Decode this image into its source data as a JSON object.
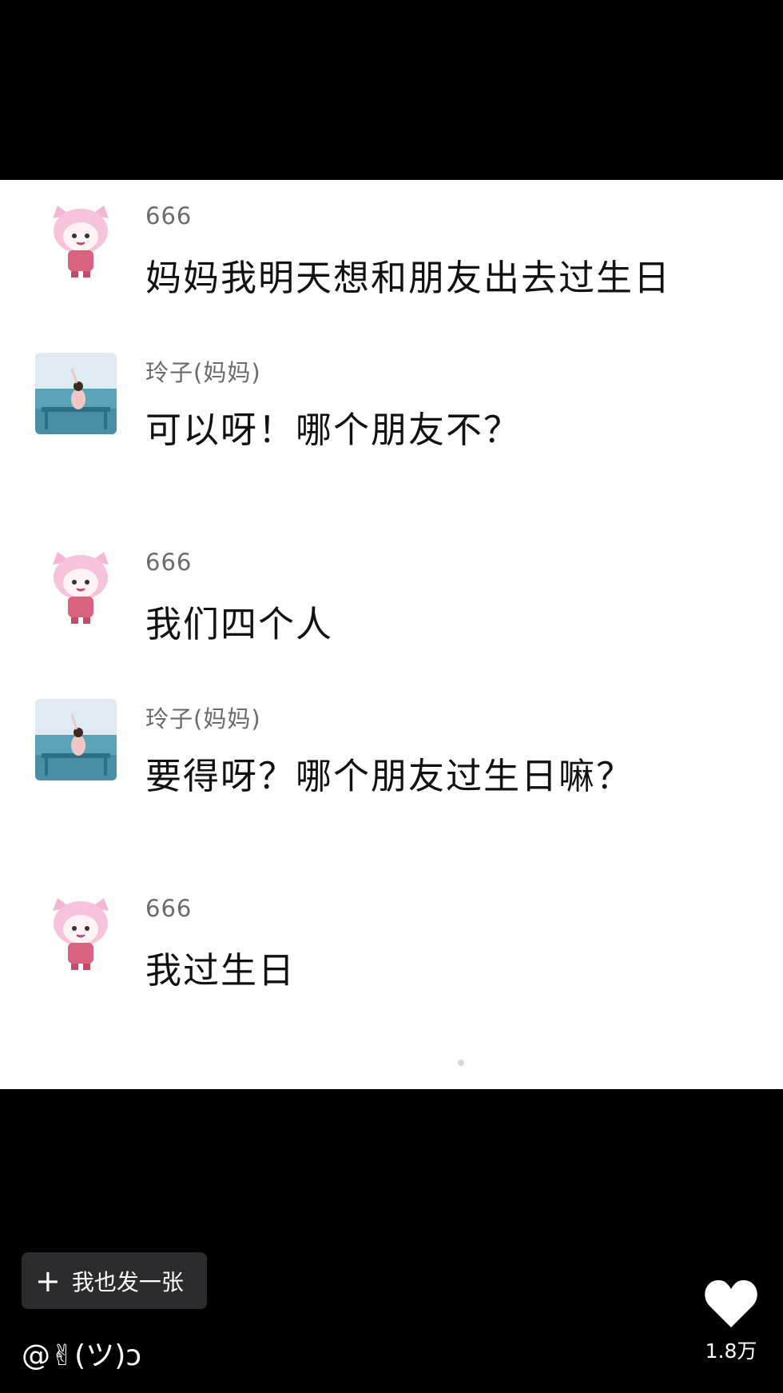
{
  "messages": [
    {
      "sender": "666",
      "avatar": "pink-cat-girl-avatar",
      "text": "妈妈我明天想和朋友出去过生日"
    },
    {
      "sender": "玲子(妈妈)",
      "avatar": "seaside-photo-avatar",
      "text": "可以呀！哪个朋友不？"
    },
    {
      "sender": "666",
      "avatar": "pink-cat-girl-avatar",
      "text": "我们四个人"
    },
    {
      "sender": "玲子(妈妈)",
      "avatar": "seaside-photo-avatar",
      "text": "要得呀？哪个朋友过生日嘛？"
    },
    {
      "sender": "666",
      "avatar": "pink-cat-girl-avatar",
      "text": "我过生日"
    }
  ],
  "footer": {
    "post_button_label": "我也发一张",
    "post_button_icon": "plus-icon",
    "username": "@✌(ツ)ↄ",
    "like_icon": "heart-icon",
    "like_count": "1.8万"
  },
  "colors": {
    "background": "#000000",
    "chat_panel": "#ffffff",
    "button_bg": "#2c2c2e",
    "sender_name": "#6b6b6b",
    "message_text": "#111111",
    "avatar_pink": "#f3b6d3",
    "avatar_sea": "#5aa3b8"
  }
}
